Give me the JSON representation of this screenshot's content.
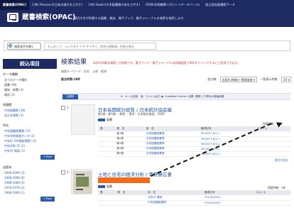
{
  "tabs": [
    {
      "label": "蔵書検索(OPAC)",
      "active": true
    },
    {
      "label": "CiNii Research(日本の論文をさがす)",
      "active": false
    },
    {
      "label": "CiNii Books(大学図書館の本をさがす)",
      "active": false
    },
    {
      "label": "IRDB(学術機関リポジトリデータベース)",
      "active": false
    },
    {
      "label": "国立国会図書館サーチ",
      "active": false
    }
  ],
  "header": {
    "title": "蔵書検索(OPAC)",
    "subtitle": "横浜大学が所蔵する図書、雑誌、電子ブック、電子ジャーナルを検索を検索します。"
  },
  "search": {
    "condition_button": "検索条件を開く",
    "query_value": "もしかして：ジュウタク トチ ケイザイ，住宅土地経済，住宅土地元"
  },
  "sidebar": {
    "header": "絞込項目",
    "sections": [
      {
        "title": "データ種類",
        "items": [
          {
            "label": "全てのデータ種別",
            "linked": false
          },
          {
            "label": "図書 (39)",
            "linked": false
          },
          {
            "label": "雑誌・新聞 (1)",
            "linked": false
          },
          {
            "label": "電話 (1)",
            "linked": false
          }
        ]
      },
      {
        "title": "所蔵館",
        "items": [
          {
            "label": "中央図書館 (18)",
            "linked": true
          },
          {
            "label": "金沢文庫館 (1)",
            "linked": true
          }
        ]
      },
      {
        "title": "所在",
        "items": [
          {
            "label": "中央図書館書庫 (17)",
            "linked": true
          },
          {
            "label": "中央学術情報センタ (2)",
            "linked": true
          },
          {
            "label": "中央LF XX(開架閲覧) (1)",
            "linked": true
          },
          {
            "label": "中央学術 2F (1)",
            "linked": true
          },
          {
            "label": "中央1F 開架 (1)",
            "linked": true
          }
        ],
        "more": "+ More"
      },
      {
        "title": "出版年",
        "items": [
          {
            "label": "2008-2009 (3)",
            "linked": true
          },
          {
            "label": "1998-2009 (6)",
            "linked": true
          },
          {
            "label": "1988-1989 (3)",
            "linked": true
          },
          {
            "label": "1978-1979 (3)",
            "linked": true
          },
          {
            "label": "1968-1969 (1)",
            "linked": true
          }
        ],
        "more": "+ More"
      }
    ]
  },
  "results": {
    "title": "検索結果",
    "note": "本学の所蔵を検索した結果です。電子ブック・電子ジャーナルは詳細画面でURLをクリックするとご利用できます。",
    "keywords": "検索キーワード：住宅　土地　経済",
    "count": "該当件数:18件",
    "sort_label": "並び順:",
    "sort_value": "出版年(降順)＋関連度順",
    "per_page_label": "一覧表示件数:",
    "per_page_value": "20"
  },
  "toolbar": {
    "select_all": "全選択",
    "email": "メール送信",
    "file": "ファイル出力",
    "endnote": "EndNote Onlineへ出力",
    "add": "選択した資料の検索結果",
    "icon_names": [
      "mail-icon",
      "file-icon",
      "endnote-icon",
      "checklist-icon"
    ]
  },
  "records": [
    {
      "number": "1.",
      "title": "日本長期統計総覧 / 日本統計協会編",
      "meta": "新1巻 - 新5巻. - 新版. - 東京：日本統計協会，2006",
      "type_label": "図書",
      "holdings_label": "所蔵件数：13件",
      "columns": [
        "巻",
        "巻　次",
        "所　在",
        "請求記号",
        "コメント"
      ],
      "rows": [
        [
          "",
          "新1巻",
          "中央図書館書庫",
          "351/N77-6/1-1",
          ""
        ],
        [
          "",
          "新2巻",
          "中央図書館書庫",
          "351/N77-6/2-1",
          ""
        ],
        [
          "",
          "新3巻",
          "中央図書館書庫",
          "351/N77-6/3-1",
          ""
        ],
        [
          "",
          "新4巻",
          "中央図書館書庫",
          "351/N77-6/4-1",
          ""
        ],
        [
          "",
          "新5巻",
          "中央図書館書庫",
          "351/N77-6/5-1",
          ""
        ]
      ],
      "more_link": "続きを見る"
    },
    {
      "number": "2.",
      "title": "土地と住宅の経済分析 / 青野勝広著",
      "type_label": "図書",
      "holdings_label": "所蔵件数：2件",
      "columns": [
        "巻",
        "巻　次",
        "所　在",
        "請求記号",
        "コメント"
      ],
      "rows": [
        [
          "",
          "",
          "中央2F 開架",
          "334.6/A55/1",
          ""
        ],
        [
          "",
          "",
          "中央図書館書庫",
          "334.6/A55/1",
          ""
        ]
      ]
    }
  ],
  "colors": {
    "navy": "#1e2b63",
    "link": "#2a5da8",
    "orange": "#f26a1b",
    "note_red": "#c0392b"
  }
}
